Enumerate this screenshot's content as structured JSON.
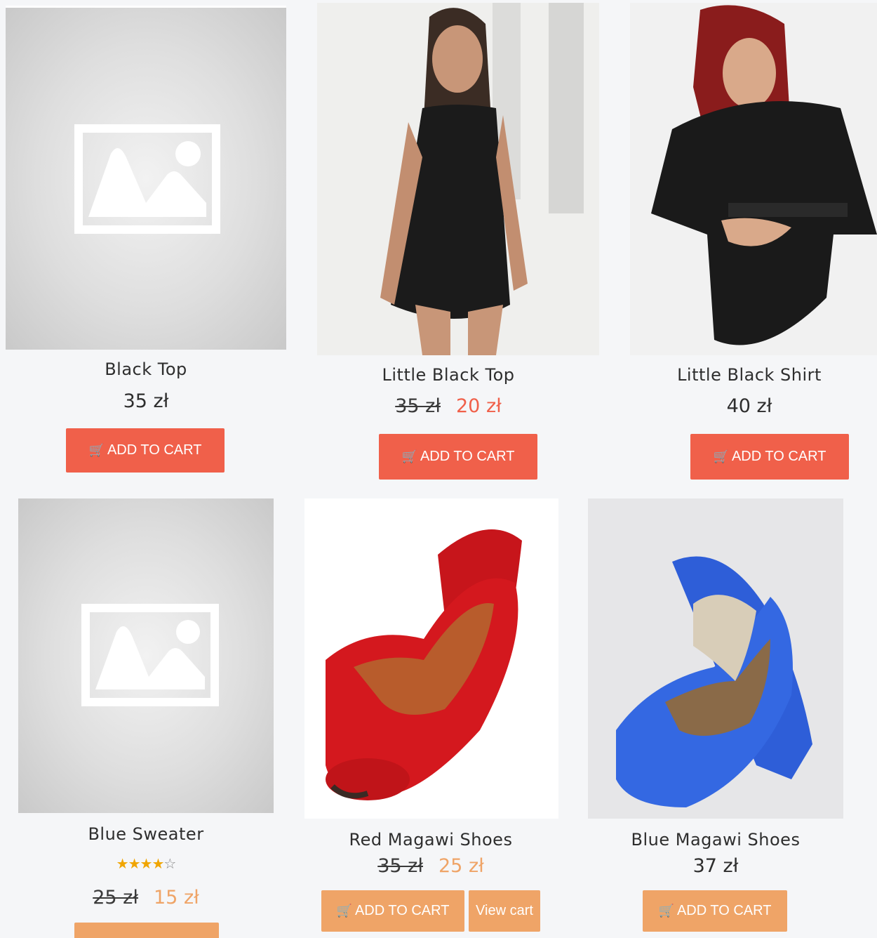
{
  "products": [
    {
      "title": "Black Top",
      "price": "35 zł",
      "button": "ADD TO CART",
      "image": "placeholder-image-icon"
    },
    {
      "title": "Little Black Top",
      "old_price": "35 zł",
      "sale_price": "20 zł",
      "button": "ADD TO CART",
      "image": "woman-black-dress-photo"
    },
    {
      "title": "Little Black Shirt",
      "price": "40 zł",
      "button": "ADD TO CART",
      "image": "redhead-woman-black-shirt-photo"
    },
    {
      "title": "Blue Sweater",
      "rating": 4,
      "rating_max": 5,
      "old_price": "25 zł",
      "sale_price": "15 zł",
      "image": "placeholder-image-icon"
    },
    {
      "title": "Red Magawi Shoes",
      "old_price": "35 zł",
      "sale_price": "25 zł",
      "button": "ADD TO CART",
      "view_cart": "View cart",
      "image": "red-heels-photo"
    },
    {
      "title": "Blue Magawi Shoes",
      "price": "37 zł",
      "button": "ADD TO CART",
      "image": "blue-heels-photo"
    }
  ],
  "colors": {
    "accent_red": "#f0604a",
    "accent_orange": "#efa467",
    "background": "#f5f6f8"
  },
  "icons": {
    "cart": "shopping-cart-icon",
    "star": "star-icon"
  }
}
